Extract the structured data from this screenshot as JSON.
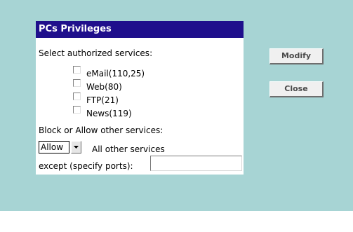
{
  "colors": {
    "page_background": "#a7d4d4",
    "title_bar": "#1f0f8c",
    "panel_background": "#ffffff",
    "bottom_band": "#ffffff"
  },
  "panel": {
    "title": "PCs Privileges",
    "services_label": "Select authorized services:",
    "services": [
      {
        "label": "eMail(110,25)",
        "checked": false
      },
      {
        "label": "Web(80)",
        "checked": false
      },
      {
        "label": "FTP(21)",
        "checked": false
      },
      {
        "label": "News(119)",
        "checked": false
      }
    ],
    "block_label": "Block or Allow other services:",
    "policy_select": {
      "selected": "Allow",
      "icon": "chevron-down-icon"
    },
    "other_services_label": "All other services",
    "except_label": "except (specify ports):",
    "ports_value": ""
  },
  "actions": {
    "modify_label": "Modify",
    "close_label": "Close"
  }
}
